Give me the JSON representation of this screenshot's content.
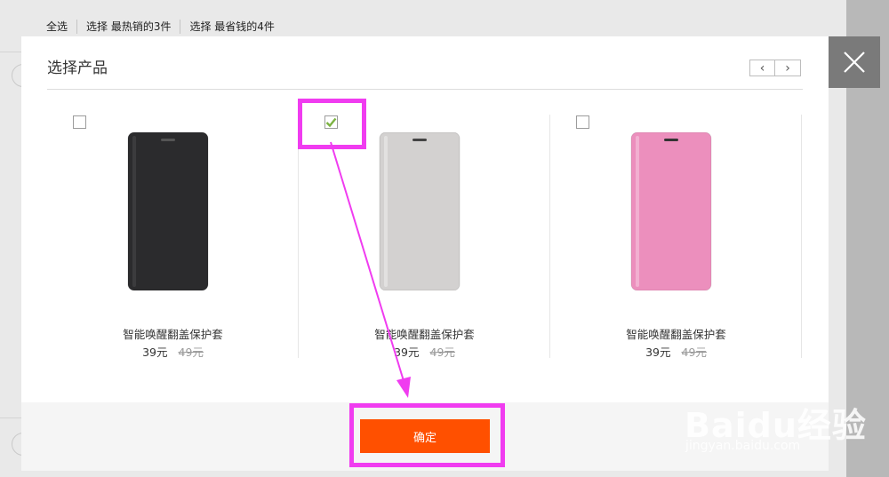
{
  "background": {
    "select_bar": [
      "全选",
      "选择 最热销的3件",
      "选择 最省钱的4件"
    ],
    "bottom_texts": [
      "",
      "",
      ""
    ]
  },
  "modal": {
    "title": "选择产品",
    "pager": {
      "prev": "‹",
      "next": "›"
    },
    "products": [
      {
        "name": "智能唤醒翻盖保护套",
        "price": "39元",
        "old_price": "49元",
        "color": "#2b2b2d",
        "checked": false
      },
      {
        "name": "智能唤醒翻盖保护套",
        "price": "39元",
        "old_price": "49元",
        "color": "#d3d1d0",
        "checked": true
      },
      {
        "name": "智能唤醒翻盖保护套",
        "price": "39元",
        "old_price": "49元",
        "color": "#ec8fbd",
        "checked": false
      }
    ],
    "confirm_label": "确定"
  },
  "colors": {
    "accent": "#ff5000",
    "annotation": "#f03cf0",
    "check": "#7cb342"
  },
  "watermark": {
    "brand": "Baidu经验",
    "url": "jingyan.baidu.com"
  }
}
